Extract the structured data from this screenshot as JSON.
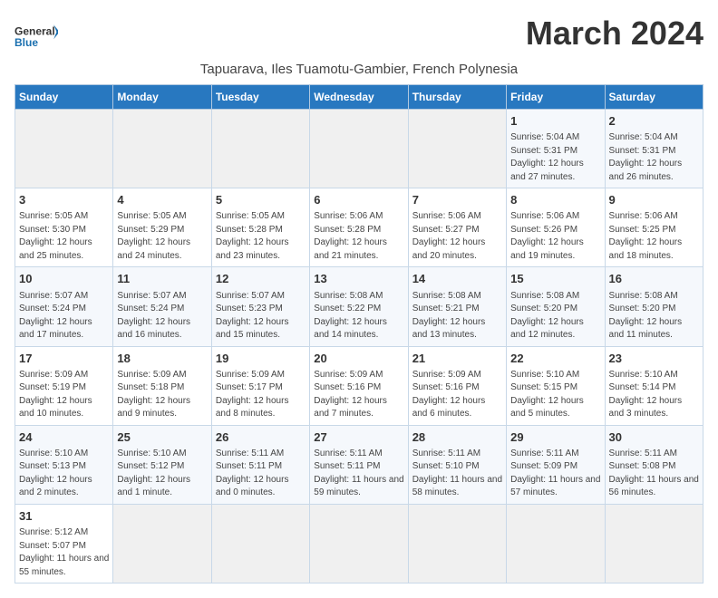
{
  "logo": {
    "text_general": "General",
    "text_blue": "Blue"
  },
  "title": "March 2024",
  "subtitle": "Tapuarava, Iles Tuamotu-Gambier, French Polynesia",
  "headers": [
    "Sunday",
    "Monday",
    "Tuesday",
    "Wednesday",
    "Thursday",
    "Friday",
    "Saturday"
  ],
  "weeks": [
    [
      {
        "day": "",
        "info": ""
      },
      {
        "day": "",
        "info": ""
      },
      {
        "day": "",
        "info": ""
      },
      {
        "day": "",
        "info": ""
      },
      {
        "day": "",
        "info": ""
      },
      {
        "day": "1",
        "info": "Sunrise: 5:04 AM\nSunset: 5:31 PM\nDaylight: 12 hours and 27 minutes."
      },
      {
        "day": "2",
        "info": "Sunrise: 5:04 AM\nSunset: 5:31 PM\nDaylight: 12 hours and 26 minutes."
      }
    ],
    [
      {
        "day": "3",
        "info": "Sunrise: 5:05 AM\nSunset: 5:30 PM\nDaylight: 12 hours and 25 minutes."
      },
      {
        "day": "4",
        "info": "Sunrise: 5:05 AM\nSunset: 5:29 PM\nDaylight: 12 hours and 24 minutes."
      },
      {
        "day": "5",
        "info": "Sunrise: 5:05 AM\nSunset: 5:28 PM\nDaylight: 12 hours and 23 minutes."
      },
      {
        "day": "6",
        "info": "Sunrise: 5:06 AM\nSunset: 5:28 PM\nDaylight: 12 hours and 21 minutes."
      },
      {
        "day": "7",
        "info": "Sunrise: 5:06 AM\nSunset: 5:27 PM\nDaylight: 12 hours and 20 minutes."
      },
      {
        "day": "8",
        "info": "Sunrise: 5:06 AM\nSunset: 5:26 PM\nDaylight: 12 hours and 19 minutes."
      },
      {
        "day": "9",
        "info": "Sunrise: 5:06 AM\nSunset: 5:25 PM\nDaylight: 12 hours and 18 minutes."
      }
    ],
    [
      {
        "day": "10",
        "info": "Sunrise: 5:07 AM\nSunset: 5:24 PM\nDaylight: 12 hours and 17 minutes."
      },
      {
        "day": "11",
        "info": "Sunrise: 5:07 AM\nSunset: 5:24 PM\nDaylight: 12 hours and 16 minutes."
      },
      {
        "day": "12",
        "info": "Sunrise: 5:07 AM\nSunset: 5:23 PM\nDaylight: 12 hours and 15 minutes."
      },
      {
        "day": "13",
        "info": "Sunrise: 5:08 AM\nSunset: 5:22 PM\nDaylight: 12 hours and 14 minutes."
      },
      {
        "day": "14",
        "info": "Sunrise: 5:08 AM\nSunset: 5:21 PM\nDaylight: 12 hours and 13 minutes."
      },
      {
        "day": "15",
        "info": "Sunrise: 5:08 AM\nSunset: 5:20 PM\nDaylight: 12 hours and 12 minutes."
      },
      {
        "day": "16",
        "info": "Sunrise: 5:08 AM\nSunset: 5:20 PM\nDaylight: 12 hours and 11 minutes."
      }
    ],
    [
      {
        "day": "17",
        "info": "Sunrise: 5:09 AM\nSunset: 5:19 PM\nDaylight: 12 hours and 10 minutes."
      },
      {
        "day": "18",
        "info": "Sunrise: 5:09 AM\nSunset: 5:18 PM\nDaylight: 12 hours and 9 minutes."
      },
      {
        "day": "19",
        "info": "Sunrise: 5:09 AM\nSunset: 5:17 PM\nDaylight: 12 hours and 8 minutes."
      },
      {
        "day": "20",
        "info": "Sunrise: 5:09 AM\nSunset: 5:16 PM\nDaylight: 12 hours and 7 minutes."
      },
      {
        "day": "21",
        "info": "Sunrise: 5:09 AM\nSunset: 5:16 PM\nDaylight: 12 hours and 6 minutes."
      },
      {
        "day": "22",
        "info": "Sunrise: 5:10 AM\nSunset: 5:15 PM\nDaylight: 12 hours and 5 minutes."
      },
      {
        "day": "23",
        "info": "Sunrise: 5:10 AM\nSunset: 5:14 PM\nDaylight: 12 hours and 3 minutes."
      }
    ],
    [
      {
        "day": "24",
        "info": "Sunrise: 5:10 AM\nSunset: 5:13 PM\nDaylight: 12 hours and 2 minutes."
      },
      {
        "day": "25",
        "info": "Sunrise: 5:10 AM\nSunset: 5:12 PM\nDaylight: 12 hours and 1 minute."
      },
      {
        "day": "26",
        "info": "Sunrise: 5:11 AM\nSunset: 5:11 PM\nDaylight: 12 hours and 0 minutes."
      },
      {
        "day": "27",
        "info": "Sunrise: 5:11 AM\nSunset: 5:11 PM\nDaylight: 11 hours and 59 minutes."
      },
      {
        "day": "28",
        "info": "Sunrise: 5:11 AM\nSunset: 5:10 PM\nDaylight: 11 hours and 58 minutes."
      },
      {
        "day": "29",
        "info": "Sunrise: 5:11 AM\nSunset: 5:09 PM\nDaylight: 11 hours and 57 minutes."
      },
      {
        "day": "30",
        "info": "Sunrise: 5:11 AM\nSunset: 5:08 PM\nDaylight: 11 hours and 56 minutes."
      }
    ],
    [
      {
        "day": "31",
        "info": "Sunrise: 5:12 AM\nSunset: 5:07 PM\nDaylight: 11 hours and 55 minutes."
      },
      {
        "day": "",
        "info": ""
      },
      {
        "day": "",
        "info": ""
      },
      {
        "day": "",
        "info": ""
      },
      {
        "day": "",
        "info": ""
      },
      {
        "day": "",
        "info": ""
      },
      {
        "day": "",
        "info": ""
      }
    ]
  ]
}
